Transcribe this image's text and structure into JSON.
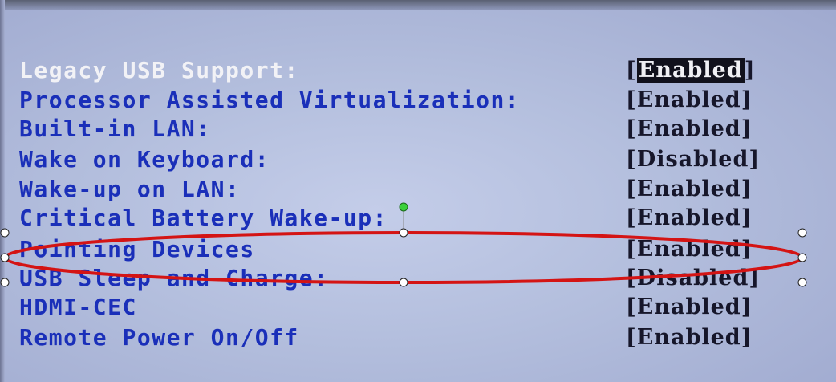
{
  "settings": [
    {
      "label": "Legacy USB Support:",
      "value": "Enabled",
      "selected": true
    },
    {
      "label": "Processor Assisted Virtualization:",
      "value": "Enabled"
    },
    {
      "label": "Built-in LAN:",
      "value": "Enabled"
    },
    {
      "label": "Wake on Keyboard:",
      "value": "Disabled"
    },
    {
      "label": "Wake-up on LAN:",
      "value": "Enabled"
    },
    {
      "label": "Critical Battery Wake-up:",
      "value": "Enabled"
    },
    {
      "label": "Pointing Devices",
      "value": "Enabled"
    },
    {
      "label": "USB Sleep and Charge:",
      "value": "Disabled"
    },
    {
      "label": "HDMI-CEC",
      "value": "Enabled"
    },
    {
      "label": "Remote Power On/Off",
      "value": "Enabled"
    }
  ],
  "colors": {
    "label": "#1a2fb9",
    "selected_label": "#f2f2f6",
    "value": "#16162a",
    "annotation": "#d41414",
    "handle_rotate": "#3ad03a"
  },
  "annotation": {
    "shape": "ellipse",
    "around": [
      "Pointing Devices",
      "USB Sleep and Charge:"
    ]
  }
}
